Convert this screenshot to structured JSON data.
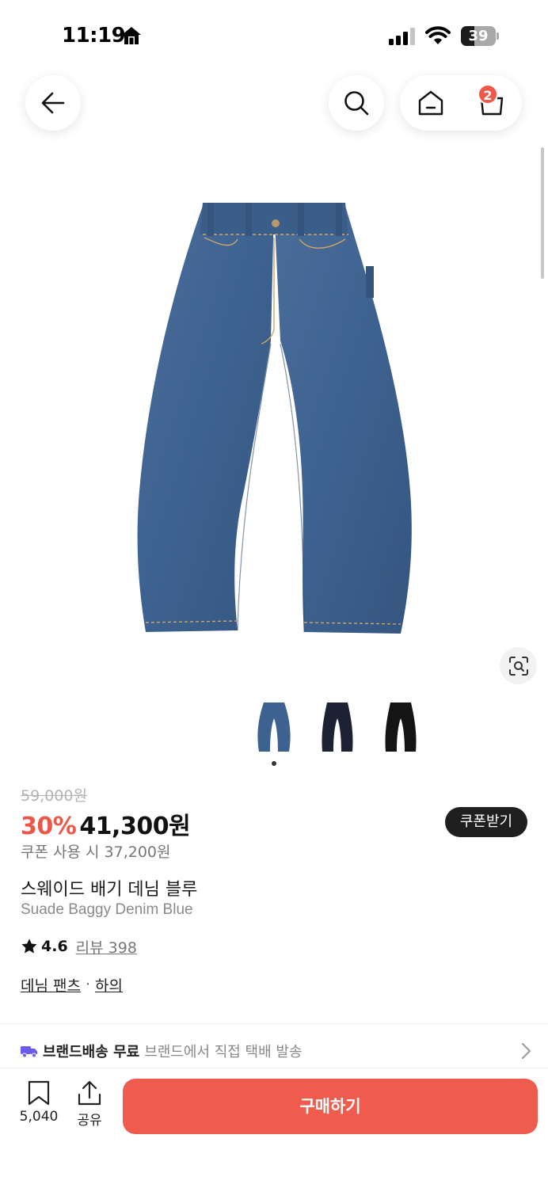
{
  "status_bar": {
    "time": "11:19",
    "battery": "39",
    "battery_level": 0.39
  },
  "header": {
    "back_icon": "arrow-left-icon",
    "search_icon": "search-icon",
    "home_icon": "home-icon",
    "cart_icon": "shopping-bag-icon",
    "cart_badge": "2"
  },
  "gallery": {
    "thumbnails": [
      "blue",
      "navy",
      "black"
    ],
    "active_index": 0
  },
  "product": {
    "original_price": "59,000원",
    "discount": "30%",
    "sale_price": "41,300원",
    "coupon_price": "쿠폰 사용 시 37,200원",
    "coupon_button": "쿠폰받기",
    "name_ko": "스웨이드 배기 데님 블루",
    "name_en": "Suade Baggy Denim Blue",
    "rating": "4.6",
    "review_link": "리뷰 398",
    "category_1": "데님 팬츠",
    "category_sep": "·",
    "category_2": "하의"
  },
  "shipping": {
    "title": "브랜드배송 무료",
    "description": "브랜드에서 직접 택배 발송"
  },
  "bottom_bar": {
    "bookmark_count": "5,040",
    "share_label": "공유",
    "buy_button": "구매하기"
  },
  "colors": {
    "accent": "#ef5c4d",
    "discount": "#ec5848",
    "denim_blue": "#3e6290",
    "navy": "#1c2233",
    "black": "#141414",
    "shipping_truck": "#6b5cf0"
  }
}
